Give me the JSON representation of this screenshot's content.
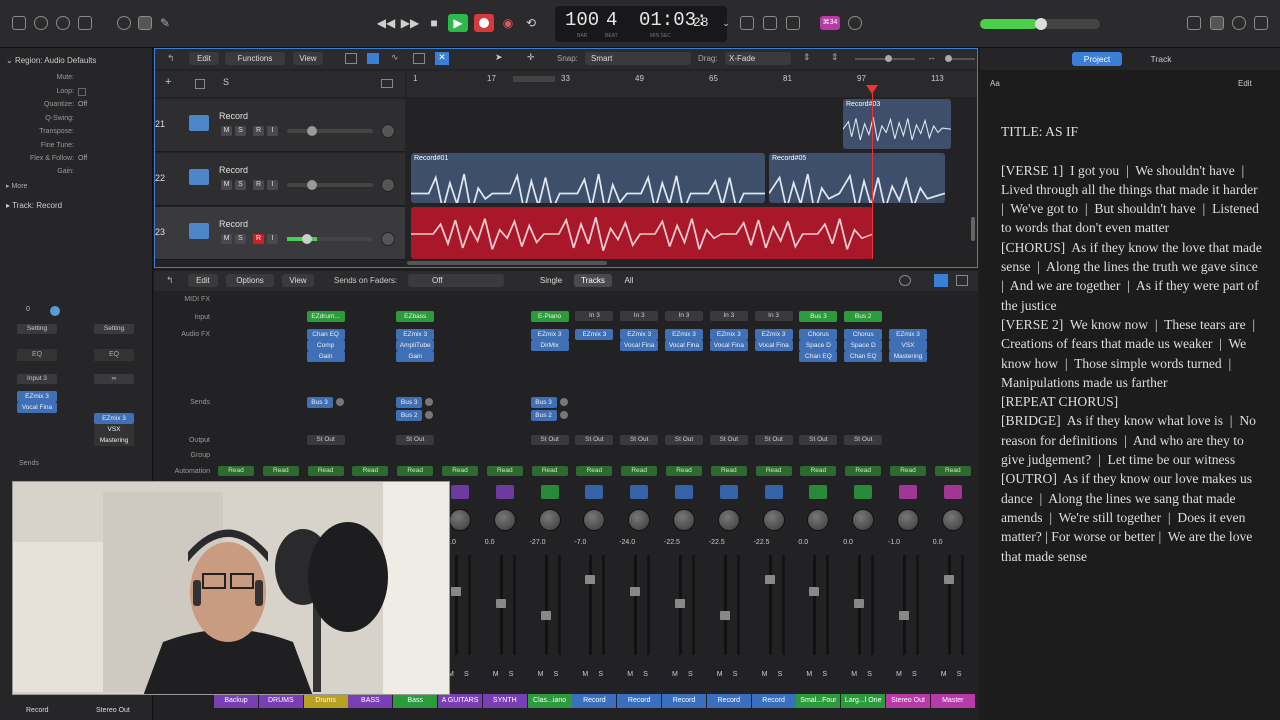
{
  "transport": {
    "bar": "100",
    "beat": "4",
    "bar_sub": "BAR",
    "beat_sub": "BEAT",
    "time": "01:03:",
    "time_frames": "28",
    "time_sub": "MIN      SEC",
    "badge": "⌘34"
  },
  "inspector": {
    "region_title": "Region: Audio Defaults",
    "rows": [
      "Mute:",
      "Loop:",
      "Quantize:",
      "Q-Swing:",
      "Transpose:",
      "Fine Tune:",
      "Flex & Follow:",
      "Gain:"
    ],
    "quantize_val": "Off",
    "flex_val": "Off",
    "more": "More",
    "track_label": "Track:",
    "track_name": "Record",
    "setting1": "Setting",
    "setting2": "Setting",
    "eq1": "EQ",
    "eq2": "EQ",
    "input": "Input 3",
    "plug1": "EZmix 3",
    "plug2": "Vocal Fina",
    "plug3": "EZmix 3",
    "plug4": "VSX",
    "plug5": "Mastering",
    "sends": "Sends",
    "zero": "0",
    "bottom_left": "Record",
    "bottom_right": "Stereo Out"
  },
  "tracks_menu": {
    "edit": "Edit",
    "functions": "Functions",
    "view": "View",
    "snap_label": "Snap:",
    "snap_val": "Smart",
    "drag_label": "Drag:",
    "drag_val": "X-Fade",
    "s_btn": "S"
  },
  "ruler": [
    "1",
    "17",
    "33",
    "49",
    "65",
    "81",
    "97",
    "113"
  ],
  "tracks": [
    {
      "num": "21",
      "name": "Record",
      "rec": false
    },
    {
      "num": "22",
      "name": "Record",
      "rec": false
    },
    {
      "num": "23",
      "name": "Record",
      "rec": true
    }
  ],
  "regions": {
    "r1": "Record#03",
    "r2": "Record#01",
    "r3": "Record#05"
  },
  "mixer_menu": {
    "edit": "Edit",
    "options": "Options",
    "view": "View",
    "sends_on_faders": "Sends on Faders:",
    "off": "Off",
    "single": "Single",
    "tracks": "Tracks",
    "all": "All"
  },
  "mixer_labels": [
    "MIDI FX",
    "Input",
    "Audio FX",
    "Sends",
    "Output",
    "Group",
    "Automation"
  ],
  "channels": [
    {
      "name": "Backup",
      "color": "#7a3fb5",
      "input": "",
      "fx": [],
      "sends": [],
      "out": "",
      "auto": "Read",
      "vol": ""
    },
    {
      "name": "DRUMS",
      "color": "#7a3fb5",
      "input": "",
      "fx": [],
      "sends": [],
      "out": "",
      "auto": "Read",
      "vol": ""
    },
    {
      "name": "Drums",
      "color": "#b8a020",
      "input": "EZdrum...",
      "fx": [
        "Chan EQ",
        "Comp",
        "Gain"
      ],
      "sends": [
        "Bus 3"
      ],
      "out": "St Out",
      "auto": "Read",
      "vol": ""
    },
    {
      "name": "BASS",
      "color": "#7a3fb5",
      "input": "",
      "fx": [],
      "sends": [],
      "out": "",
      "auto": "Read",
      "vol": ""
    },
    {
      "name": "Bass",
      "color": "#2c9b3c",
      "input": "EZbass",
      "fx": [
        "EZmix 3",
        "AmpliTube",
        "Gain"
      ],
      "sends": [
        "Bus 3",
        "Bus 2"
      ],
      "out": "St Out",
      "auto": "Read",
      "vol": ""
    },
    {
      "name": "A GUITARS",
      "color": "#7a3fb5",
      "input": "",
      "fx": [],
      "sends": [],
      "out": "",
      "auto": "Read",
      "vol": "-24.0"
    },
    {
      "name": "SYNTH",
      "color": "#7a3fb5",
      "input": "",
      "fx": [],
      "sends": [],
      "out": "",
      "auto": "Read",
      "vol": "0.0"
    },
    {
      "name": "Clas...iano",
      "color": "#2c9b3c",
      "input": "E-Piano",
      "fx": [
        "EZmix 3",
        "DirMix"
      ],
      "sends": [
        "Bus 3",
        "Bus 2"
      ],
      "out": "St Out",
      "auto": "Read",
      "vol": "-27.0"
    },
    {
      "name": "Record",
      "color": "#3a6fbf",
      "input": "In 3",
      "fx": [
        "EZmix 3"
      ],
      "sends": [],
      "out": "St Out",
      "auto": "Read",
      "vol": "-7.0"
    },
    {
      "name": "Record",
      "color": "#3a6fbf",
      "input": "In 3",
      "fx": [
        "EZmix 3",
        "Vocal Fina"
      ],
      "sends": [],
      "out": "St Out",
      "auto": "Read",
      "vol": "-24.0"
    },
    {
      "name": "Record",
      "color": "#3a6fbf",
      "input": "In 3",
      "fx": [
        "EZmix 3",
        "Vocal Fina"
      ],
      "sends": [],
      "out": "St Out",
      "auto": "Read",
      "vol": "-22.5"
    },
    {
      "name": "Record",
      "color": "#3a6fbf",
      "input": "In 3",
      "fx": [
        "EZmix 3",
        "Vocal Fina"
      ],
      "sends": [],
      "out": "St Out",
      "auto": "Read",
      "vol": "-22.5"
    },
    {
      "name": "Record",
      "color": "#3a6fbf",
      "input": "In 3",
      "fx": [
        "EZmix 3",
        "Vocal Fina"
      ],
      "sends": [],
      "out": "St Out",
      "auto": "Read",
      "vol": "-22.5"
    },
    {
      "name": "Smal...Four",
      "color": "#2c9b3c",
      "input": "Bus 3",
      "fx": [
        "Chorus",
        "Space D",
        "Chan EQ"
      ],
      "sends": [],
      "out": "St Out",
      "auto": "Read",
      "vol": "0.0"
    },
    {
      "name": "Larg...l One",
      "color": "#2c9b3c",
      "input": "Bus 2",
      "fx": [
        "Chorus",
        "Space D",
        "Chan EQ"
      ],
      "sends": [],
      "out": "St Out",
      "auto": "Read",
      "vol": "0.0"
    },
    {
      "name": "Stereo Out",
      "color": "#b83aa8",
      "input": "",
      "fx": [
        "EZmix 3",
        "VSX",
        "Mastering"
      ],
      "sends": [],
      "out": "",
      "auto": "Read",
      "vol": "-1.0"
    },
    {
      "name": "Master",
      "color": "#b83aa8",
      "input": "",
      "fx": [],
      "sends": [],
      "out": "",
      "auto": "Read",
      "vol": "0.0"
    }
  ],
  "right_panel": {
    "tab_project": "Project",
    "tab_track": "Track",
    "aa": "Aa",
    "edit": "Edit",
    "lyrics": "TITLE: AS IF\n\n[VERSE 1]  I got you  |  We shouldn't have  |  Lived through all the things that made it harder  |  We've got to  |  But shouldn't have  |  Listened to words that don't even matter\n[CHORUS]  As if they know the love that made sense  |  Along the lines the truth we gave since  |  And we are together  |  As if they were part of the justice\n[VERSE 2]  We know now  |  These tears are  |  Creations of fears that made us weaker  |  We know how  |  Those simple words turned  |  Manipulations made us farther\n[REPEAT CHORUS]\n[BRIDGE]  As if they know what love is  |  No reason for definitions  |  And who are they to give judgement?  |  Let time be our witness\n[OUTRO]  As if they know our love makes us dance  |  Along the lines we sang that made amends  |  We're still together  |  Does it even matter? | For worse or better |  We are the love that made sense"
  },
  "colors": {
    "accent": "#3a7fd6",
    "rec_region": "#a8182a",
    "blue_region": "#3d4f6b",
    "play": "#2fb84a",
    "record": "#d63a3a"
  }
}
